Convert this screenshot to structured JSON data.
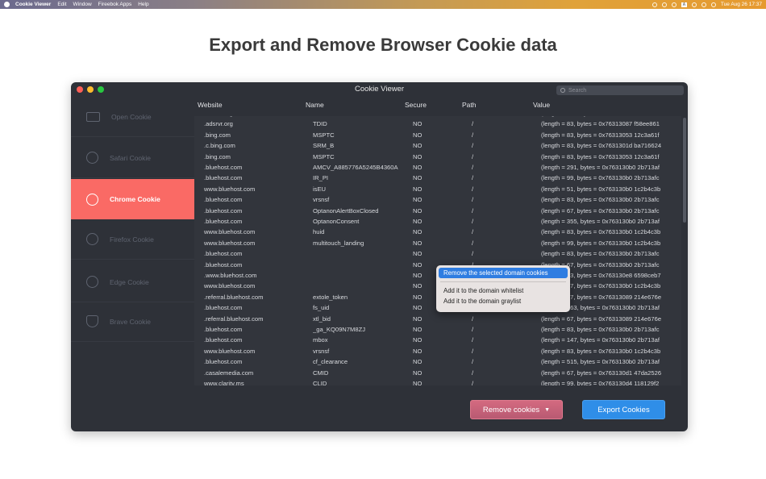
{
  "menubar": {
    "app_name": "Cookie Viewer",
    "items": [
      "Edit",
      "Window",
      "Fireebok Apps",
      "Help"
    ],
    "tray_letter": "A",
    "clock": "Tue Aug 26  17:37"
  },
  "headline": "Export and Remove Browser Cookie data",
  "window": {
    "title": "Cookie Viewer",
    "search_placeholder": "Search"
  },
  "sidebar": {
    "items": [
      {
        "label": "Open Cookie",
        "icon": "folder-icon"
      },
      {
        "label": "Safari Cookie",
        "icon": "compass-icon"
      },
      {
        "label": "Chrome Cookie",
        "icon": "chrome-icon"
      },
      {
        "label": "Firefox Cookie",
        "icon": "firefox-icon"
      },
      {
        "label": "Edge Cookie",
        "icon": "edge-icon"
      },
      {
        "label": "Brave Cookie",
        "icon": "brave-shield-icon"
      }
    ],
    "active_index": 2
  },
  "table": {
    "columns": [
      "Website",
      "Name",
      "Secure",
      "Path",
      "Value"
    ],
    "rows": [
      [
        ".adsrvr.org",
        "TDCPM",
        "NO",
        "/",
        "(length = 243, bytes = 0x763130b0 7d3e2b8"
      ],
      [
        ".adsrvr.org",
        "TDID",
        "NO",
        "/",
        "(length = 83, bytes = 0x76313087 f58ee861"
      ],
      [
        ".bing.com",
        "MSPTC",
        "NO",
        "/",
        "(length = 83, bytes = 0x76313053 12c3a61f"
      ],
      [
        ".c.bing.com",
        "SRM_B",
        "NO",
        "/",
        "(length = 83, bytes = 0x7631301d ba716624"
      ],
      [
        ".bing.com",
        "MSPTC",
        "NO",
        "/",
        "(length = 83, bytes = 0x76313053 12c3a61f"
      ],
      [
        ".bluehost.com",
        "AMCV_A885776A5245B4360A",
        "NO",
        "/",
        "(length = 291, bytes = 0x763130b0 2b713af"
      ],
      [
        ".bluehost.com",
        "IR_PI",
        "NO",
        "/",
        "(length = 99, bytes = 0x763130b0 2b713afc"
      ],
      [
        "www.bluehost.com",
        "isEU",
        "NO",
        "/",
        "(length = 51, bytes = 0x763130b0 1c2b4c3b"
      ],
      [
        ".bluehost.com",
        "vrsnsf",
        "NO",
        "/",
        "(length = 83, bytes = 0x763130b0 2b713afc"
      ],
      [
        ".bluehost.com",
        "OptanonAlertBoxClosed",
        "NO",
        "/",
        "(length = 67, bytes = 0x763130b0 2b713afc"
      ],
      [
        ".bluehost.com",
        "OptanonConsent",
        "NO",
        "/",
        "(length = 355, bytes = 0x763130b0 2b713af"
      ],
      [
        "www.bluehost.com",
        "huid",
        "NO",
        "/",
        "(length = 83, bytes = 0x763130b0 1c2b4c3b"
      ],
      [
        "www.bluehost.com",
        "multitouch_landing",
        "NO",
        "/",
        "(length = 99, bytes = 0x763130b0 1c2b4c3b"
      ],
      [
        ".bluehost.com",
        "",
        "NO",
        "/",
        "(length = 83, bytes = 0x763130b0 2b713afc"
      ],
      [
        ".bluehost.com",
        "",
        "NO",
        "/",
        "(length = 67, bytes = 0x763130b0 2b713afc"
      ],
      [
        ".www.bluehost.com",
        "",
        "NO",
        "/",
        "(length = 83, bytes = 0x763130e8 6598ceb7"
      ],
      [
        "www.bluehost.com",
        "",
        "NO",
        "/",
        "(length = 67, bytes = 0x763130b0 1c2b4c3b"
      ],
      [
        ".referral.bluehost.com",
        "extole_token",
        "NO",
        "/",
        "(length = 67, bytes = 0x76313089 214e676e"
      ],
      [
        ".bluehost.com",
        "fs_uid",
        "NO",
        "/",
        "(length = 163, bytes = 0x763130b0 2b713af"
      ],
      [
        ".referral.bluehost.com",
        "xtl_bid",
        "NO",
        "/",
        "(length = 67, bytes = 0x76313089 214e676e"
      ],
      [
        ".bluehost.com",
        "_ga_KQ09N7M8ZJ",
        "NO",
        "/",
        "(length = 83, bytes = 0x763130b0 2b713afc"
      ],
      [
        ".bluehost.com",
        "mbox",
        "NO",
        "/",
        "(length = 147, bytes = 0x763130b0 2b713af"
      ],
      [
        "www.bluehost.com",
        "vrsnsf",
        "NO",
        "/",
        "(length = 83, bytes = 0x763130b0 1c2b4c3b"
      ],
      [
        ".bluehost.com",
        "cf_clearance",
        "NO",
        "/",
        "(length = 515, bytes = 0x763130b0 2b713af"
      ],
      [
        ".casalemedia.com",
        "CMID",
        "NO",
        "/",
        "(length = 67, bytes = 0x763130d1 47da2526"
      ],
      [
        "www.clarity.ms",
        "CLID",
        "NO",
        "/",
        "(length = 99, bytes = 0x763130d4 118129f2"
      ]
    ]
  },
  "context_menu": {
    "items": [
      "Remove the selected domain cookies",
      "Add it to the domain whitelist",
      "Add it to the domain graylist"
    ]
  },
  "buttons": {
    "remove": "Remove  cookies",
    "remove_caret": "▼",
    "export": "Export Cookies"
  }
}
